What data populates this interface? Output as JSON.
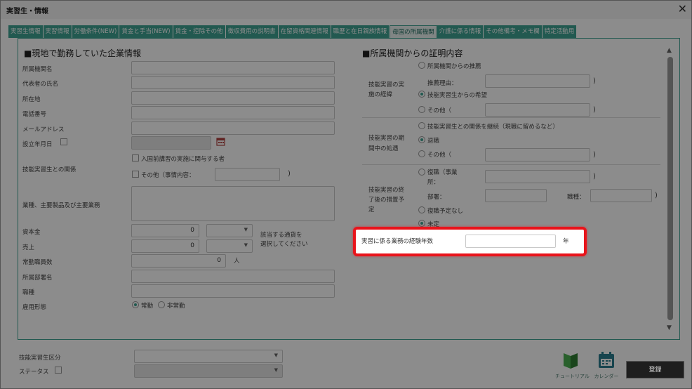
{
  "window": {
    "title": "実習生・情報",
    "close_icon": "close-icon"
  },
  "tabs": [
    "実習生情報",
    "実習情報",
    "労働条件(NEW)",
    "賃金と手当(NEW)",
    "賃金・控除その他",
    "徴収費用の説明書",
    "在留資格関連情報",
    "職歴と在日親族情報",
    "母国の所属機関",
    "介護に係る情報",
    "その他備考・メモ欄",
    "特定活動用"
  ],
  "active_tab_index": 8,
  "left": {
    "section_title": "■現地で勤務していた企業情報",
    "org_name_label": "所属機関名",
    "rep_name_label": "代表者の氏名",
    "address_label": "所在地",
    "phone_label": "電話番号",
    "email_label": "メールアドレス",
    "established_label": "設立年月日",
    "relation_label": "技能実習生との関係",
    "relation_opt1": "入国前講習の実施に関与する者",
    "relation_opt2": "その他（事情内容：",
    "relation_close": ")",
    "business_label": "業種、主要製品及び主要業務",
    "capital_label": "資本金",
    "capital_value": "0",
    "sales_label": "売上",
    "sales_value": "0",
    "currency_hint_line1": "該当する通貨を",
    "currency_hint_line2": "選択してください",
    "employees_label": "常勤職員数",
    "employees_value": "0",
    "employees_unit": "人",
    "department_label": "所属部署名",
    "position_label": "職種",
    "employment_label": "雇用形態",
    "employment_opt1": "常勤",
    "employment_opt2": "非常勤"
  },
  "right": {
    "section_title": "■所属機関からの証明内容",
    "history_label_line1": "技能実習の実",
    "history_label_line2": "施の経緯",
    "history_opt1": "所属機関からの推薦",
    "history_reason_label": "推薦理由：",
    "history_opt2": "技能実習生からの希望",
    "history_opt3": "その他（",
    "period_label_line1": "技能実習の期",
    "period_label_line2": "間中の処遇",
    "period_opt1": "技能実習生との関係を継続（現職に留めるなど）",
    "period_opt2": "退職",
    "period_opt3": "その他（",
    "after_label_line1": "技能実習の終",
    "after_label_line2": "了後の措置予",
    "after_label_line3": "定",
    "after_opt1_line1": "復職（事業",
    "after_opt1_line2": "所：",
    "after_dept_label": "部署：",
    "after_position_label": "職種：",
    "after_opt2": "復職予定なし",
    "after_opt3": "未定",
    "paren_close": ")",
    "experience_label": "実習に係る業務の経験年数",
    "experience_value": "",
    "experience_unit": "年"
  },
  "footer": {
    "category_label": "技能実習生区分",
    "status_label": "ステータス",
    "tutorial_label": "チュートリアル",
    "calendar_label": "カレンダー",
    "submit_label": "登録"
  },
  "colors": {
    "accent": "#3fa392",
    "highlight": "#e8141b"
  }
}
